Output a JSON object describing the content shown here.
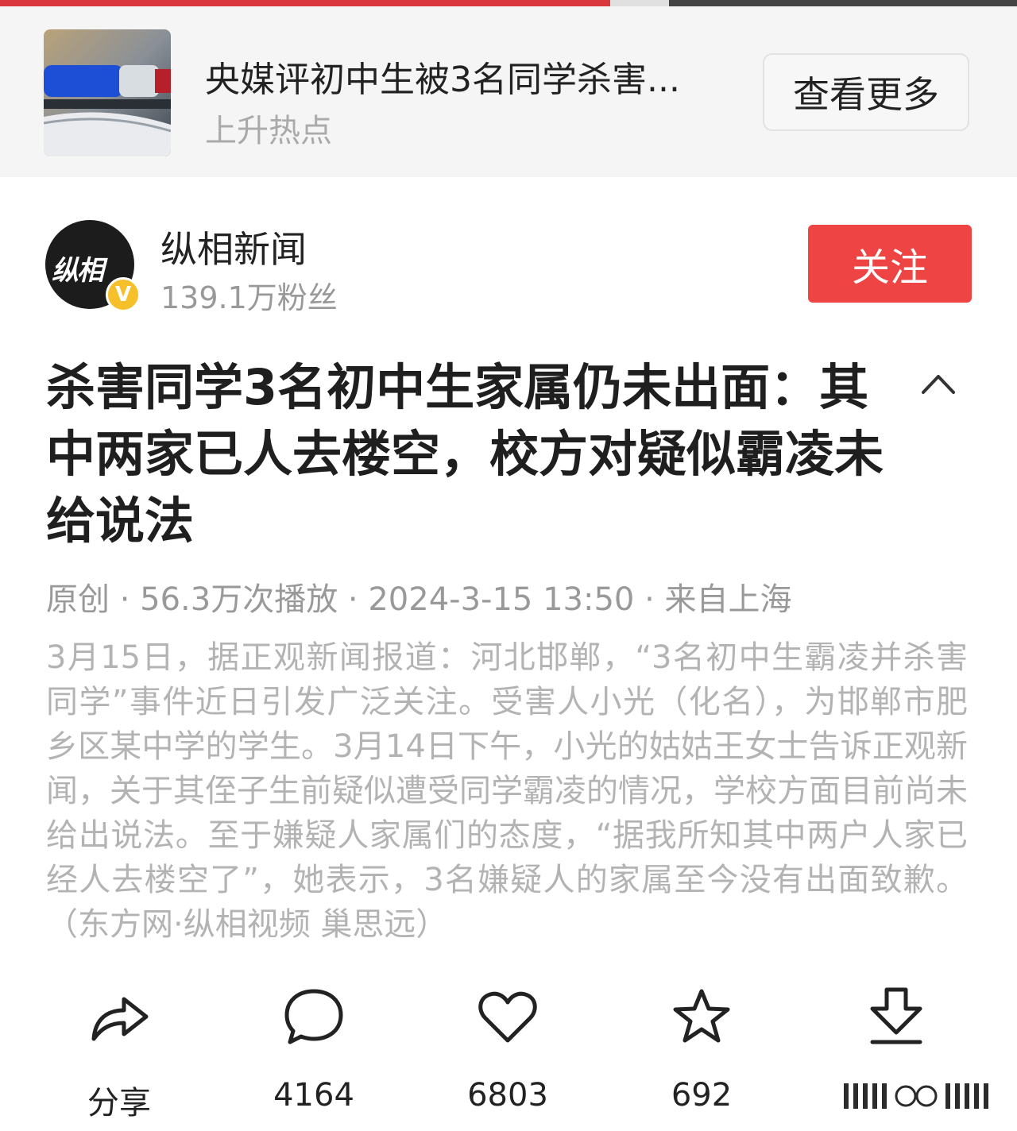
{
  "hot_banner": {
    "title": "央媒评初中生被3名同学杀害...",
    "subtitle": "上升热点",
    "more_label": "查看更多"
  },
  "author": {
    "name": "纵相新闻",
    "fans": "139.1万粉丝",
    "avatar_text": "纵相",
    "verified_badge": "V",
    "follow_label": "关注"
  },
  "article": {
    "title": "杀害同学3名初中生家属仍未出面：其中两家已人去楼空，校方对疑似霸凌未给说法",
    "meta": "原创 · 56.3万次播放 · 2024-3-15 13:50 · 来自上海",
    "summary": "3月15日，据正观新闻报道：河北邯郸，“3名初中生霸凌并杀害同学”事件近日引发广泛关注。受害人小光（化名），为邯郸市肥乡区某中学的学生。3月14日下午，小光的姑姑王女士告诉正观新闻，关于其侄子生前疑似遭受同学霸凌的情况，学校方面目前尚未给出说法。至于嫌疑人家属们的态度，“据我所知其中两户人家已经人去楼空了”，她表示，3名嫌疑人的家属至今没有出面致歉。（东方网·纵相视频 巢思远）"
  },
  "progress": 0.6,
  "actions": {
    "share_label": "分享",
    "comment_count": "4164",
    "like_count": "6803",
    "favorite_count": "692",
    "download_label": ""
  },
  "colors": {
    "accent": "#ef4444",
    "text_primary": "#222222",
    "text_secondary": "#999999",
    "summary_text": "#b3b3b3",
    "verified": "#f6c02b"
  },
  "icons": {
    "collapse": "chevron-up-icon",
    "share": "share-arrow-icon",
    "comment": "comment-bubble-icon",
    "like": "heart-icon",
    "favorite": "star-icon",
    "download": "download-icon"
  }
}
